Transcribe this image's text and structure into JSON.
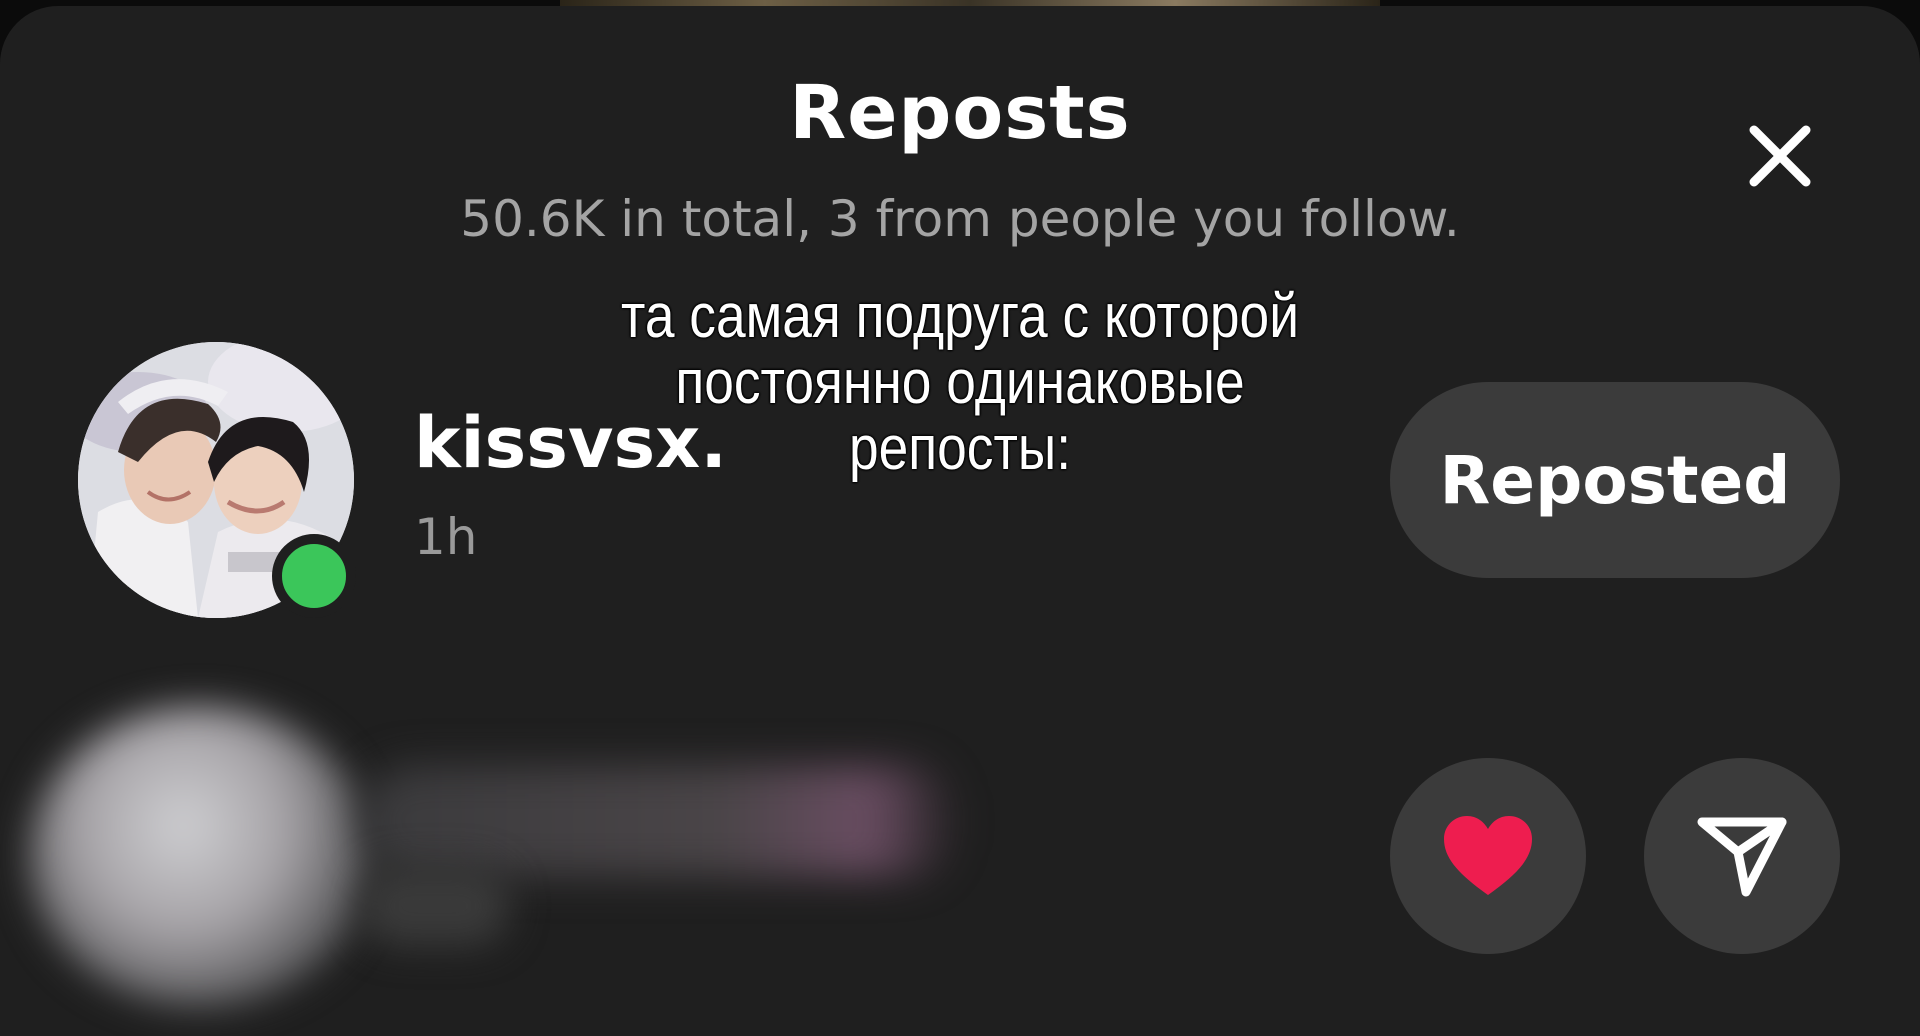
{
  "header": {
    "title": "Reposts",
    "subtitle": "50.6K in total, 3 from people you follow."
  },
  "reposts": [
    {
      "username": "kissvsx.",
      "time": "1h",
      "status": "online",
      "action_label": "Reposted"
    },
    {
      "username": "",
      "blurred": true,
      "actions": [
        "heart-icon",
        "send-icon"
      ]
    }
  ],
  "overlay_caption": {
    "lines": [
      "та самая подруга с которой",
      "постоянно одинаковые",
      "репосты:"
    ]
  },
  "colors": {
    "sheet_background": "#1f1f1f",
    "button_background": "#3b3b3b",
    "online_indicator": "#3bc65a",
    "heart": "#ee1d4f"
  }
}
